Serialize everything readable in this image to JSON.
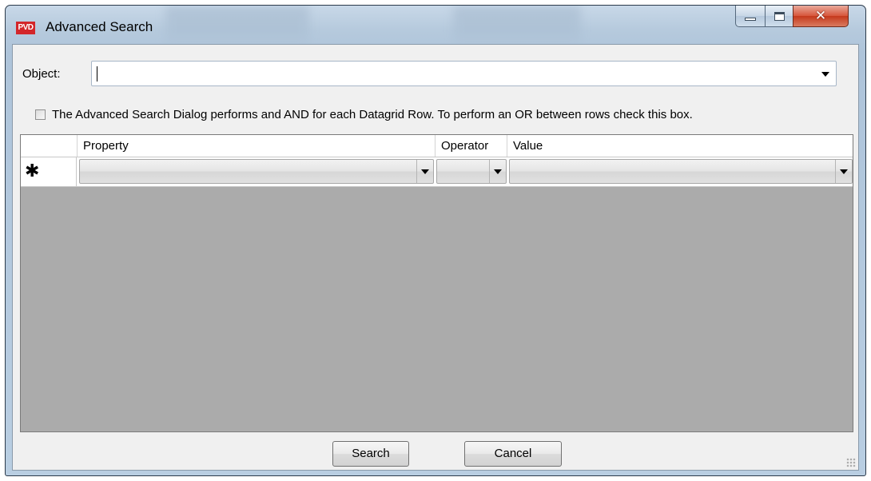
{
  "window": {
    "title": "Advanced Search",
    "icon_text": "PVD",
    "controls": {
      "minimize": "minimize-icon",
      "maximize": "maximize-icon",
      "close": "close-icon"
    }
  },
  "object_field": {
    "label": "Object:",
    "value": ""
  },
  "or_checkbox": {
    "checked": false,
    "label": "The Advanced Search Dialog performs and AND for each Datagrid Row.  To perform an OR between rows check this box."
  },
  "grid": {
    "columns": [
      "Property",
      "Operator",
      "Value"
    ],
    "new_row_marker": "✱",
    "rows": [
      {
        "property": "",
        "operator": "",
        "value": ""
      }
    ]
  },
  "buttons": {
    "search": "Search",
    "cancel": "Cancel"
  },
  "colors": {
    "grid_background": "#ababab",
    "dialog_background": "#f0f0f0",
    "close_button": "#c5391c"
  }
}
